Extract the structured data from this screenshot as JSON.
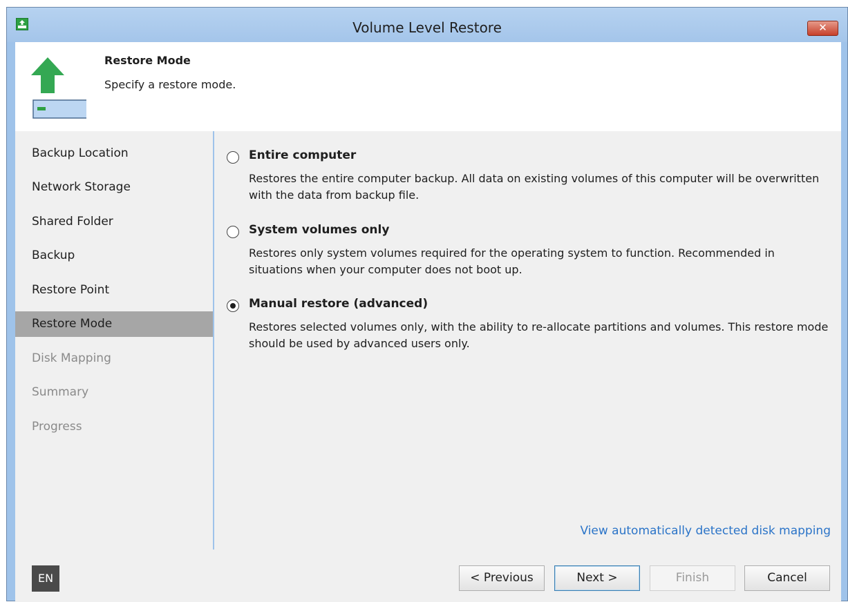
{
  "window": {
    "title": "Volume Level Restore",
    "close_label": "✕"
  },
  "header": {
    "title": "Restore Mode",
    "subtitle": "Specify a restore mode."
  },
  "sidebar": {
    "items": [
      {
        "label": "Backup Location",
        "state": "normal"
      },
      {
        "label": "Network Storage",
        "state": "normal"
      },
      {
        "label": "Shared Folder",
        "state": "normal"
      },
      {
        "label": "Backup",
        "state": "normal"
      },
      {
        "label": "Restore Point",
        "state": "normal"
      },
      {
        "label": "Restore Mode",
        "state": "active"
      },
      {
        "label": "Disk Mapping",
        "state": "disabled"
      },
      {
        "label": "Summary",
        "state": "disabled"
      },
      {
        "label": "Progress",
        "state": "disabled"
      }
    ]
  },
  "options": [
    {
      "title": "Entire computer",
      "description": "Restores the entire computer backup. All data on existing volumes of this computer will be overwritten with the data from backup file.",
      "selected": false
    },
    {
      "title": "System volumes only",
      "description": "Restores only system volumes required for the operating system to function. Recommended in situations when your computer does not boot up.",
      "selected": false
    },
    {
      "title": "Manual restore (advanced)",
      "description": "Restores selected volumes only, with the ability to re-allocate partitions and volumes. This restore mode should be used by advanced users only.",
      "selected": true
    }
  ],
  "link_text": "View automatically detected disk mapping",
  "footer": {
    "language": "EN",
    "previous": "< Previous",
    "next": "Next >",
    "finish": "Finish",
    "cancel": "Cancel"
  },
  "colors": {
    "accent_link": "#2b74c8",
    "brand_green": "#2ea043",
    "active_step": "#a6a6a6"
  }
}
